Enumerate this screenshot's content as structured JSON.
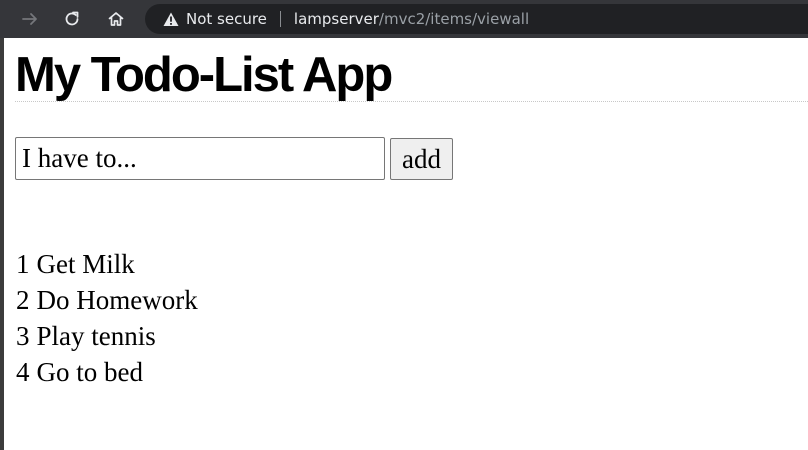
{
  "browser": {
    "security_label": "Not secure",
    "url_host": "lampserver",
    "url_path": "/mvc2/items/viewall"
  },
  "page": {
    "title": "My Todo-List App",
    "input_placeholder": "I have to...",
    "add_label": "add",
    "items": [
      {
        "id": "1",
        "text": "Get Milk"
      },
      {
        "id": "2",
        "text": "Do Homework"
      },
      {
        "id": "3",
        "text": "Play tennis"
      },
      {
        "id": "4",
        "text": "Go to bed"
      }
    ]
  }
}
